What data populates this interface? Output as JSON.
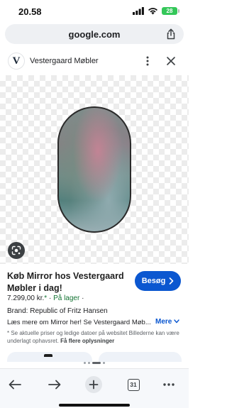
{
  "status_bar": {
    "time": "20.58",
    "battery": "28"
  },
  "browser": {
    "url": "google.com"
  },
  "site": {
    "logo_letter": "V",
    "name": "Vestergaard Møbler"
  },
  "product": {
    "title": "Køb Mirror hos Vestergaard Møbler i dag!",
    "visit_label": "Besøg",
    "price": "7.299,00 kr.",
    "price_suffix": "*",
    "separator": "·",
    "stock": "På lager",
    "brand": "Brand: Republic of Fritz Hansen",
    "description": "Læs mere om Mirror her! Se Vestergaard Møb...",
    "more_label": "Mere",
    "disclaimer_text": "* Se aktuelle priser og ledige datoer på websitet Billederne kan være underlagt ophavsret.",
    "disclaimer_link": "Få flere oplysninger"
  },
  "toolbar": {
    "tab_count": "31"
  },
  "icons": {
    "share": "share-icon",
    "more": "more-vert-icon",
    "close": "close-icon",
    "lens": "lens-icon",
    "back": "back-arrow-icon",
    "forward": "forward-arrow-icon",
    "new_tab": "plus-icon",
    "menu": "more-horiz-icon",
    "signal": "signal-icon",
    "wifi": "wifi-icon"
  },
  "colors": {
    "accent": "#0b57d0",
    "stock": "#137333",
    "battery": "#34c759"
  }
}
